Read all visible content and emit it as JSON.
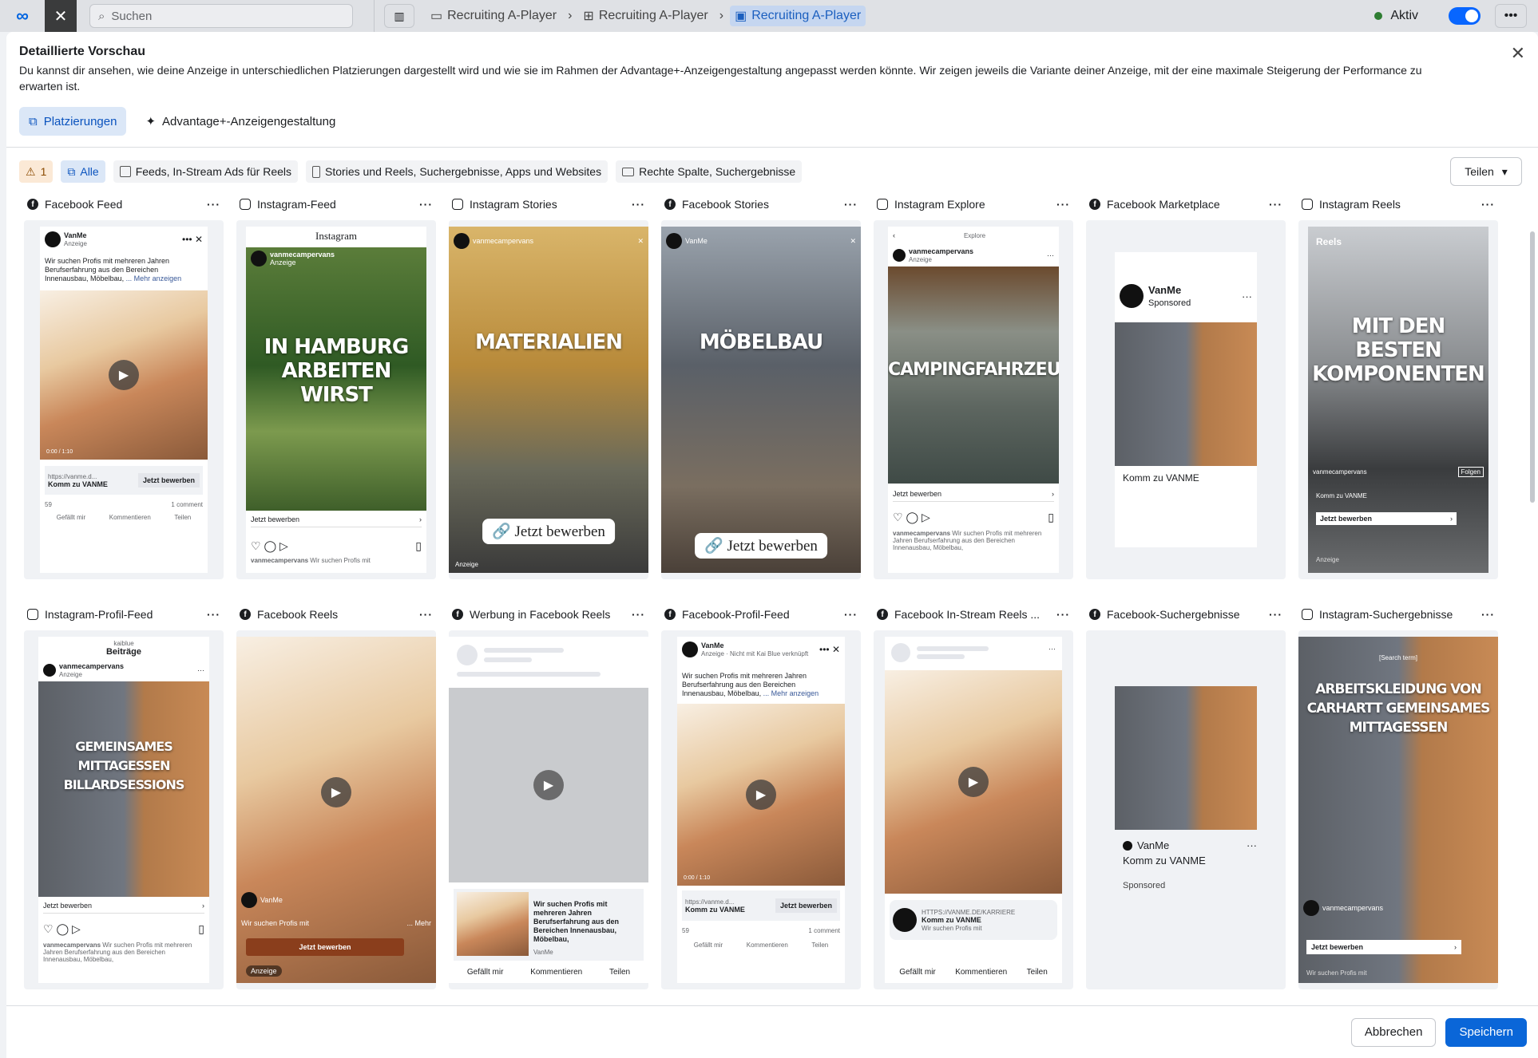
{
  "topbar": {
    "search_placeholder": "Suchen",
    "breadcrumbs": [
      "Recruiting A-Player",
      "Recruiting A-Player",
      "Recruiting A-Player"
    ],
    "status": "Aktiv"
  },
  "modal": {
    "title": "Detaillierte Vorschau",
    "description": "Du kannst dir ansehen, wie deine Anzeige in unterschiedlichen Platzierungen dargestellt wird und wie sie im Rahmen der Advantage+-Anzeigengestaltung angepasst werden könnte. Wir zeigen jeweils die Variante deiner Anzeige, mit der eine maximale Steigerung der Performance zu erwarten ist.",
    "tabs": [
      "Platzierungen",
      "Advantage+-Anzeigengestaltung"
    ],
    "filters": {
      "warning_count": "1",
      "all": "Alle",
      "feeds": "Feeds, In-Stream Ads für Reels",
      "stories": "Stories und Reels, Suchergebnisse, Apps und Websites",
      "right_column": "Rechte Spalte, Suchergebnisse"
    },
    "share": "Teilen",
    "cancel": "Abbrechen",
    "save": "Speichern"
  },
  "ad": {
    "brand": "VanMe",
    "handle": "vanmecampervans",
    "sponsored_de": "Anzeige",
    "sponsored_en": "Sponsored",
    "primary_text": "Wir suchen Profis mit mehreren Jahren Berufserfahrung aus den Bereichen Innenausbau, Möbelbau,",
    "more": "... Mehr anzeigen",
    "headline": "Komm zu VANME",
    "url": "https://vanme.d...",
    "cta": "Jetzt bewerben",
    "cta_link": "Jetzt bewerben",
    "reactions": "59",
    "comments": "1 comment",
    "like": "Gefällt mir",
    "comment": "Kommentieren",
    "share": "Teilen",
    "video_time": "0:00 / 1:10",
    "karriere_url": "HTTPS://VANME.DE/KARRIERE",
    "search_term": "[Search term]",
    "explore": "Explore",
    "reels": "Reels",
    "follow": "Folgen",
    "insta_header": "kaiblue",
    "beitraege": "Beiträge",
    "not_with": "Anzeige · Nicht mit Kai Blue verknüpft",
    "short_text": "Wir suchen Profis mit",
    "mehr": "... Mehr"
  },
  "overlays": {
    "hamburg": "IN HAMBURG ARBEITEN WIRST",
    "materialien": "MATERIALIEN",
    "moebelbau": "MÖBELBAU",
    "camping": "CAMPINGFAHRZEUGEN",
    "komponenten": "MIT DEN BESTEN KOMPONENTEN",
    "mittagessen": "GEMEINSAMES MITTAGESSEN BILLARDSESSIONS",
    "carhartt": "ARBEITSKLEIDUNG VON CARHARTT GEMEINSAMES MITTAGESSEN"
  },
  "placements_row1": [
    "Facebook Feed",
    "Instagram-Feed",
    "Instagram Stories",
    "Facebook Stories",
    "Instagram Explore",
    "Facebook Marketplace",
    "Instagram Reels"
  ],
  "placements_row2": [
    "Instagram-Profil-Feed",
    "Facebook Reels",
    "Werbung in Facebook Reels",
    "Facebook-Profil-Feed",
    "Facebook In-Stream Reels ...",
    "Facebook-Suchergebnisse",
    "Instagram-Suchergebnisse"
  ],
  "colors": {
    "primary": "#0a66d8",
    "selected_bg": "#dbe7f7",
    "warning_bg": "#fbe9d6"
  }
}
